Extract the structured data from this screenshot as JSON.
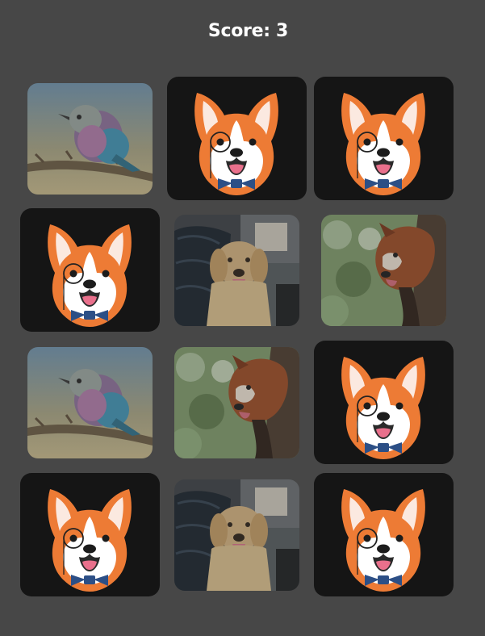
{
  "score": {
    "label": "Score: 3"
  },
  "colors": {
    "background": "#474747",
    "card_back": "#151515",
    "corgi_orange": "#ed7b35",
    "bow_tie_blue": "#2c4f86"
  },
  "cards": [
    {
      "state": "face-up",
      "image": "bird-photo"
    },
    {
      "state": "face-down",
      "image": "corgi-logo"
    },
    {
      "state": "face-down",
      "image": "corgi-logo"
    },
    {
      "state": "face-down",
      "image": "corgi-logo"
    },
    {
      "state": "face-up",
      "image": "golden-retriever-photo"
    },
    {
      "state": "face-up",
      "image": "red-panda-photo"
    },
    {
      "state": "face-up",
      "image": "bird-photo"
    },
    {
      "state": "face-up",
      "image": "red-panda-photo"
    },
    {
      "state": "face-down",
      "image": "corgi-logo"
    },
    {
      "state": "face-down",
      "image": "corgi-logo"
    },
    {
      "state": "face-up",
      "image": "golden-retriever-photo"
    },
    {
      "state": "face-down",
      "image": "corgi-logo"
    }
  ]
}
